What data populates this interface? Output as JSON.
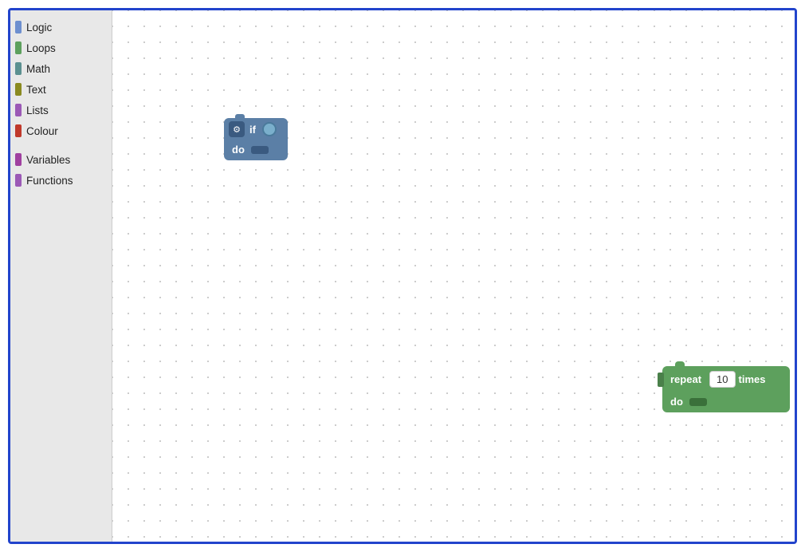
{
  "sidebar": {
    "items": [
      {
        "label": "Logic",
        "color": "#6d8fcf",
        "id": "logic"
      },
      {
        "label": "Loops",
        "color": "#5da05d",
        "id": "loops"
      },
      {
        "label": "Math",
        "color": "#5b9090",
        "id": "math"
      },
      {
        "label": "Text",
        "color": "#8a8a20",
        "id": "text"
      },
      {
        "label": "Lists",
        "color": "#9b59b6",
        "id": "lists"
      },
      {
        "label": "Colour",
        "color": "#c0392b",
        "id": "colour"
      },
      {
        "label": "Variables",
        "color": "#a040a0",
        "id": "variables"
      },
      {
        "label": "Functions",
        "color": "#9b59b6",
        "id": "functions"
      }
    ]
  },
  "if_block": {
    "gear_symbol": "⚙",
    "if_label": "if",
    "do_label": "do"
  },
  "repeat_block": {
    "repeat_label": "repeat",
    "value": "10",
    "times_label": "times",
    "do_label": "do"
  }
}
